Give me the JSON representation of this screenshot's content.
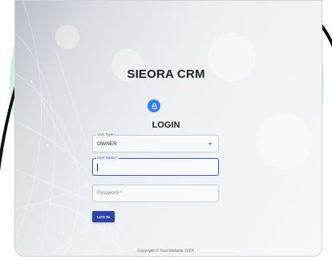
{
  "app": {
    "title": "SIEORA CRM"
  },
  "login": {
    "heading": "LOGIN",
    "user_type": {
      "label": "User Type",
      "value": "OWNER"
    },
    "user_name": {
      "label": "User Name *",
      "value": ""
    },
    "password": {
      "placeholder": "Password *"
    },
    "submit_label": "LOG IN"
  },
  "footer": {
    "copyright": "Copyright © Your Website 2024."
  },
  "icons": {
    "lock": "lock-icon",
    "dropdown": "chevron-down-icon"
  },
  "colors": {
    "accent": "#2d45a8",
    "focus": "#3a56c9",
    "lock_badge": "#2e7cf6",
    "background_circle": "#cfeedd"
  }
}
